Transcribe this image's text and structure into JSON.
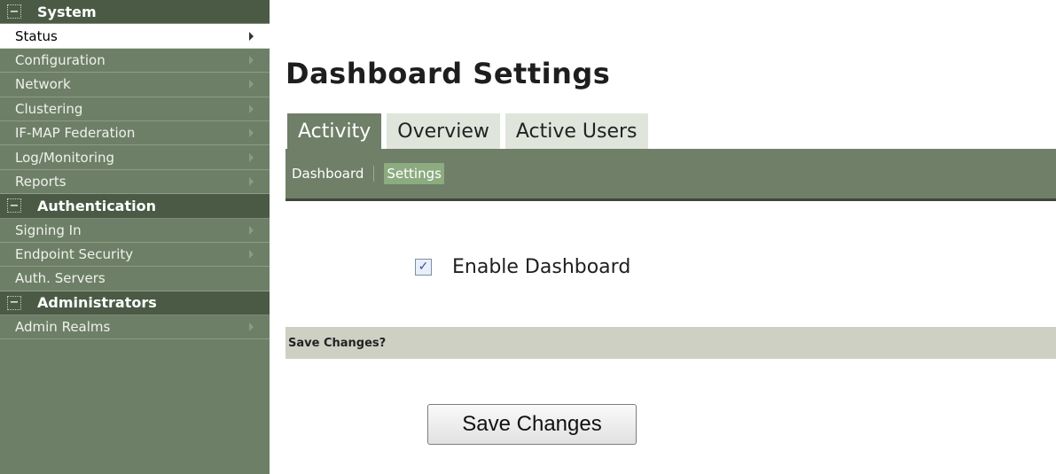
{
  "sidebar": {
    "sections": [
      {
        "title": "System",
        "items": [
          {
            "label": "Status",
            "active": true,
            "arrow": true
          },
          {
            "label": "Configuration",
            "arrow": true
          },
          {
            "label": "Network",
            "arrow": true
          },
          {
            "label": "Clustering",
            "arrow": true
          },
          {
            "label": "IF-MAP Federation",
            "arrow": true
          },
          {
            "label": "Log/Monitoring",
            "arrow": true
          },
          {
            "label": "Reports",
            "arrow": true
          }
        ]
      },
      {
        "title": "Authentication",
        "items": [
          {
            "label": "Signing In",
            "arrow": true
          },
          {
            "label": "Endpoint Security",
            "arrow": true
          },
          {
            "label": "Auth. Servers",
            "arrow": false
          }
        ]
      },
      {
        "title": "Administrators",
        "items": [
          {
            "label": "Admin Realms",
            "arrow": true
          }
        ]
      }
    ]
  },
  "page": {
    "title": "Dashboard Settings"
  },
  "tabs": [
    {
      "label": "Activity",
      "active": true
    },
    {
      "label": "Overview"
    },
    {
      "label": "Active Users"
    }
  ],
  "subnav": {
    "dashboard": "Dashboard",
    "settings": "Settings"
  },
  "form": {
    "enable_label": "Enable Dashboard",
    "enable_checked": true
  },
  "save_bar": {
    "title": "Save Changes?"
  },
  "buttons": {
    "save": "Save Changes"
  },
  "colors": {
    "sidebar_bg": "#6e7f68",
    "section_bg": "#4a5a45",
    "active_tab": "#6f7f68",
    "inactive_tab": "#dfe5db",
    "save_bar_bg": "#cfd0c4"
  },
  "icons": {
    "section_toggle": "minus-box-icon",
    "item_arrow": "triangle-right-icon",
    "checkbox": "checkmark-icon"
  }
}
